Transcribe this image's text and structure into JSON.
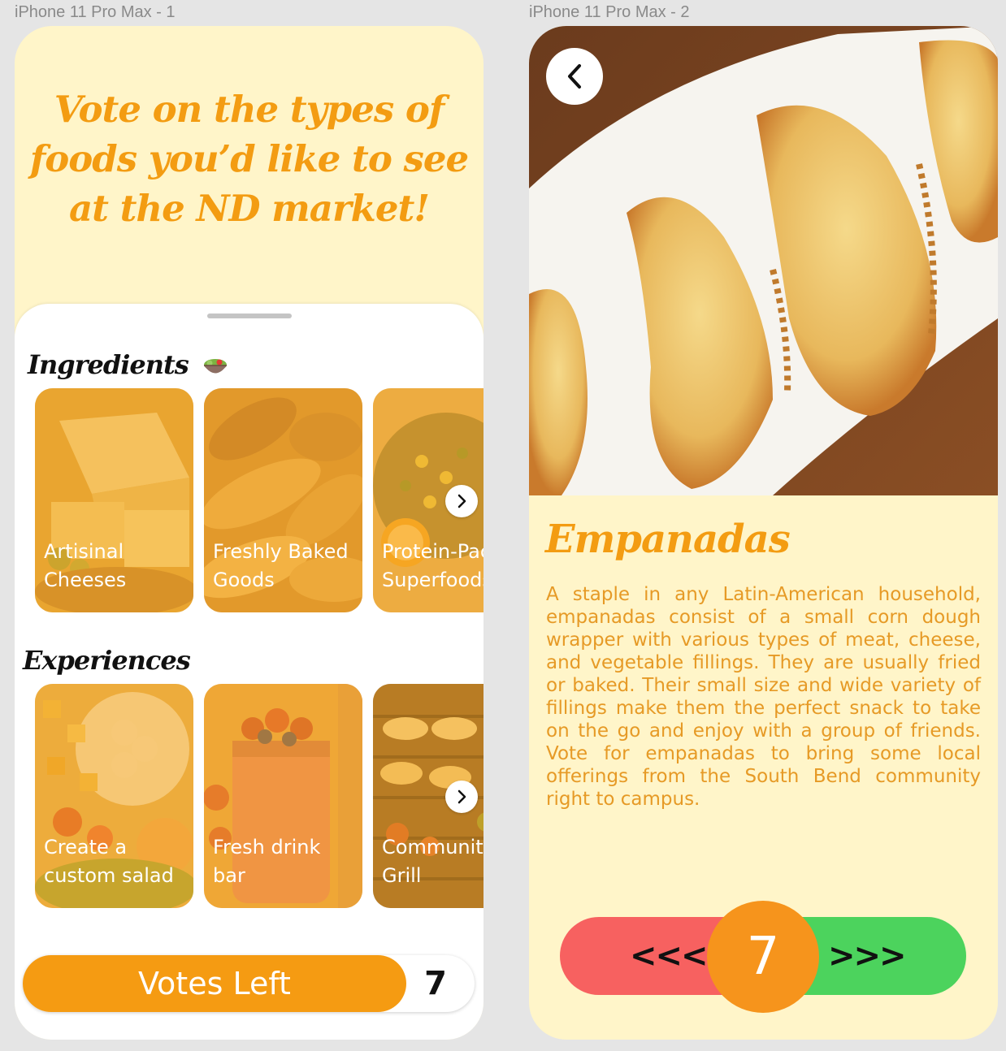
{
  "frames": {
    "left_label": "iPhone 11 Pro Max - 1",
    "right_label": "iPhone 11 Pro Max - 2"
  },
  "screen1": {
    "headline": "Vote on the types of foods you’d like to see at the ND market!",
    "ingredients_title": "Ingredients",
    "ingredients": [
      {
        "label": "Artisinal\nCheeses"
      },
      {
        "label": "Freshly Baked\nGoods"
      },
      {
        "label": "Protein-Packed\nSuperfoods"
      }
    ],
    "experiences_title": "Experiences",
    "experiences": [
      {
        "label": "Create a\ncustom salad"
      },
      {
        "label": "Fresh drink\nbar"
      },
      {
        "label": "Community\nGrill"
      }
    ],
    "votes_label": "Votes Left",
    "votes_count": "7"
  },
  "screen2": {
    "title": "Empanadas",
    "description": "A staple in any Latin-American household, empanadas consist of a small corn dough wrapper with various types of meat, cheese, and vegetable fillings. They are usually fried or baked. Their small size and wide variety of fillings make them the perfect snack to take on the go and enjoy with a group of friends. Vote for empanadas to bring some local offerings from the South Bend community right to campus.",
    "left_arrows": "<<<",
    "right_arrows": ">>>",
    "vote_count": "7"
  },
  "colors": {
    "accent": "#f59b12",
    "background": "#fff5c9",
    "reject": "#f76160",
    "approve": "#4cd35d"
  }
}
